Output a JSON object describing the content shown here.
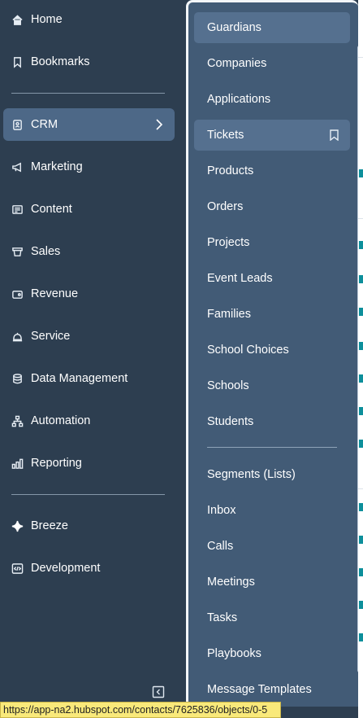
{
  "nav": {
    "items": [
      {
        "label": "Home",
        "icon": "home-icon"
      },
      {
        "label": "Bookmarks",
        "icon": "bookmark-icon"
      },
      {
        "label": "CRM",
        "icon": "crm-icon",
        "active": true
      },
      {
        "label": "Marketing",
        "icon": "megaphone-icon"
      },
      {
        "label": "Content",
        "icon": "content-icon"
      },
      {
        "label": "Sales",
        "icon": "sales-icon"
      },
      {
        "label": "Revenue",
        "icon": "wallet-icon"
      },
      {
        "label": "Service",
        "icon": "bell-service-icon"
      },
      {
        "label": "Data Management",
        "icon": "database-icon"
      },
      {
        "label": "Automation",
        "icon": "workflow-icon"
      },
      {
        "label": "Reporting",
        "icon": "bar-chart-icon"
      },
      {
        "label": "Breeze",
        "icon": "sparkle-icon"
      },
      {
        "label": "Development",
        "icon": "code-icon"
      }
    ]
  },
  "crm_menu": {
    "items": [
      {
        "label": "Guardians"
      },
      {
        "label": "Companies"
      },
      {
        "label": "Applications"
      },
      {
        "label": "Tickets",
        "bookmark": true
      },
      {
        "label": "Products"
      },
      {
        "label": "Orders"
      },
      {
        "label": "Projects"
      },
      {
        "label": "Event Leads"
      },
      {
        "label": "Families"
      },
      {
        "label": "School Choices"
      },
      {
        "label": "Schools"
      },
      {
        "label": "Students"
      },
      {
        "label": "Segments (Lists)"
      },
      {
        "label": "Inbox"
      },
      {
        "label": "Calls"
      },
      {
        "label": "Meetings"
      },
      {
        "label": "Tasks"
      },
      {
        "label": "Playbooks"
      },
      {
        "label": "Message Templates"
      }
    ]
  },
  "status_bar": {
    "url": "https://app-na2.hubspot.com/contacts/7625836/objects/0-5"
  },
  "colors": {
    "nav_bg": "#2d3e50",
    "active_bg": "#4d6887",
    "flyout_bg": "#425b76",
    "flyout_highlight": "#55708f",
    "status_bg": "#f9e97a"
  }
}
